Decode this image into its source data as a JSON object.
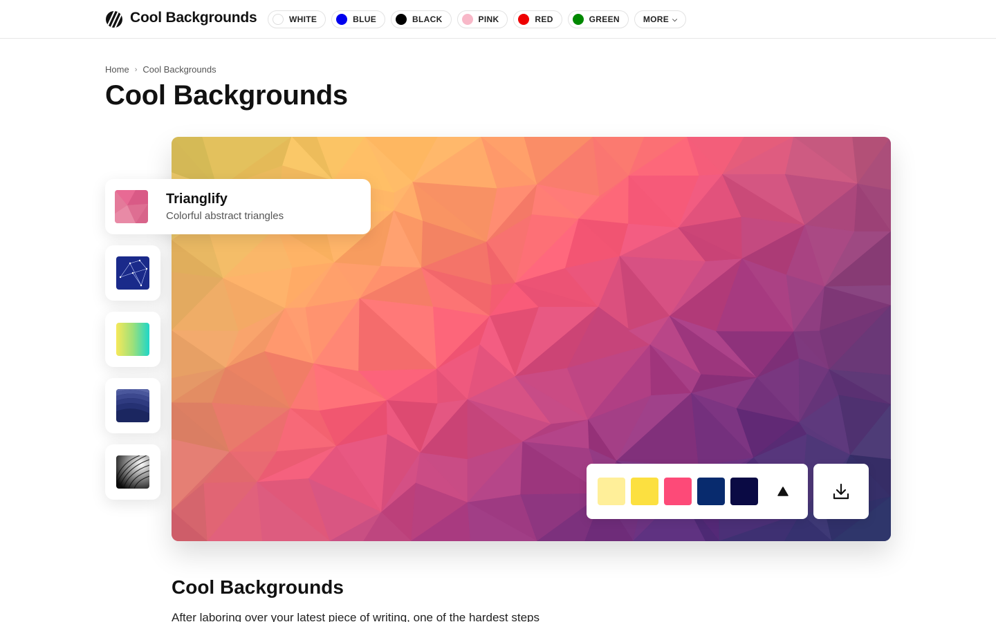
{
  "header": {
    "brand": "Cool Backgrounds",
    "logo_icon": "striped-circle-logo-icon",
    "colors": [
      {
        "label": "WHITE",
        "color": "#ffffff"
      },
      {
        "label": "BLUE",
        "color": "#0000ee"
      },
      {
        "label": "BLACK",
        "color": "#000000"
      },
      {
        "label": "PINK",
        "color": "#f8b8c8"
      },
      {
        "label": "RED",
        "color": "#ee0000"
      },
      {
        "label": "GREEN",
        "color": "#008800"
      }
    ],
    "more_label": "MORE"
  },
  "breadcrumb": {
    "home": "Home",
    "current": "Cool Backgrounds"
  },
  "page_title": "Cool Backgrounds",
  "generators": {
    "active": {
      "name": "Trianglify",
      "description": "Colorful abstract triangles"
    },
    "others": [
      "constellation-thumbnail",
      "gradient-thumbnail",
      "waves-thumbnail",
      "spiral-thumbnail"
    ]
  },
  "palette": {
    "swatches": [
      "#ffef99",
      "#fce040",
      "#fd4a78",
      "#082b6e",
      "#0a0a44"
    ],
    "shape_icon": "triangle-icon",
    "download_icon": "download-icon"
  },
  "article": {
    "title": "Cool Backgrounds",
    "intro": "After laboring over your latest piece of writing, one of the hardest steps"
  }
}
